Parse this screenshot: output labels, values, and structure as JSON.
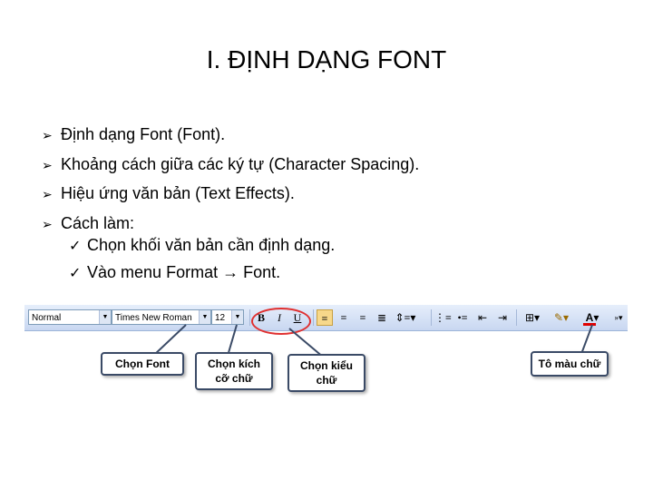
{
  "slide": {
    "title": "I. ĐỊNH DẠNG FONT",
    "bullets": [
      "Định dạng Font (Font).",
      "Khoảng cách giữa các ký tự (Character Spacing).",
      "Hiệu ứng văn bản (Text Effects).",
      "Cách làm:"
    ],
    "sub_bullets": [
      "Chọn khối văn bản cần định dạng.",
      "Vào menu Format"
    ],
    "sub_bullet_suffix": "Font."
  },
  "toolbar": {
    "style_value": "Normal",
    "font_value": "Times New Roman",
    "size_value": "12",
    "bold_label": "B",
    "italic_label": "I",
    "underline_label": "U"
  },
  "callouts": {
    "font": "Chọn Font",
    "size_line1": "Chọn kích",
    "size_line2": "cỡ chữ",
    "style_line1": "Chọn kiểu",
    "style_line2": "chữ",
    "color": "Tô màu chữ"
  },
  "colors": {
    "ring": "#e03030",
    "font_color_bar": "#e00000",
    "toolbar": "#c8d7f1"
  }
}
